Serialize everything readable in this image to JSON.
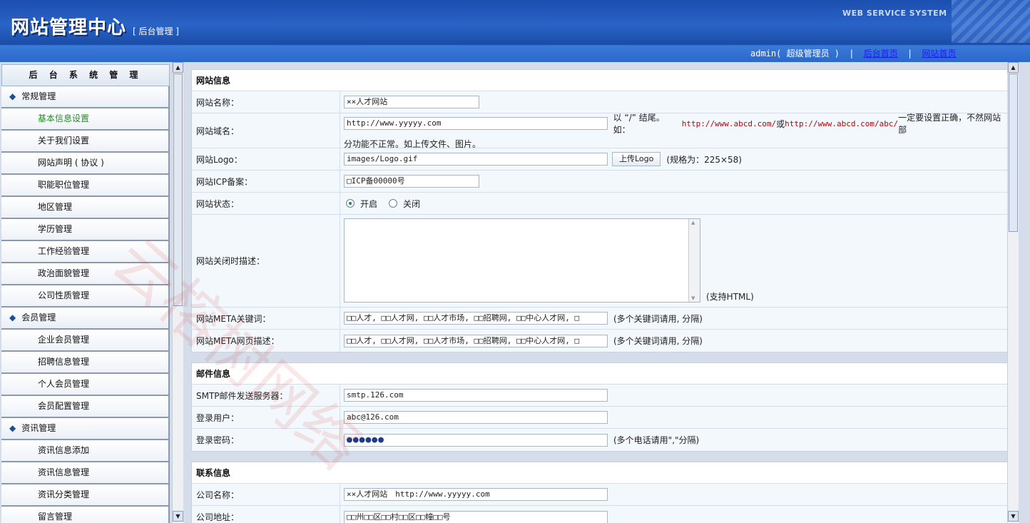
{
  "header": {
    "title": "网站管理中心",
    "subtitle": "[ 后台管理 ]",
    "system_label": "WEB SERVICE SYSTEM",
    "user": "admin( 超级管理员 )",
    "links": [
      "后台首页",
      "网站首页"
    ]
  },
  "sidebar": {
    "title": "后 台 系 统 管 理",
    "items": [
      {
        "type": "group",
        "label": "常规管理"
      },
      {
        "type": "item",
        "label": "基本信息设置",
        "active": true
      },
      {
        "type": "item",
        "label": "关于我们设置"
      },
      {
        "type": "item",
        "label": "网站声明 ( 协议 )"
      },
      {
        "type": "item",
        "label": "职能职位管理"
      },
      {
        "type": "item",
        "label": "地区管理"
      },
      {
        "type": "item",
        "label": "学历管理"
      },
      {
        "type": "item",
        "label": "工作经验管理"
      },
      {
        "type": "item",
        "label": "政治面貌管理"
      },
      {
        "type": "item",
        "label": "公司性质管理"
      },
      {
        "type": "group",
        "label": "会员管理"
      },
      {
        "type": "item",
        "label": "企业会员管理"
      },
      {
        "type": "item",
        "label": "招聘信息管理"
      },
      {
        "type": "item",
        "label": "个人会员管理"
      },
      {
        "type": "item",
        "label": "会员配置管理"
      },
      {
        "type": "group",
        "label": "资讯管理"
      },
      {
        "type": "item",
        "label": "资讯信息添加"
      },
      {
        "type": "item",
        "label": "资讯信息管理"
      },
      {
        "type": "item",
        "label": "资讯分类管理"
      },
      {
        "type": "item",
        "label": "留言管理"
      }
    ]
  },
  "site_info": {
    "heading": "网站信息",
    "name_label": "网站名称：",
    "name_value": "××人才网站",
    "domain_label": "网站域名：",
    "domain_value": "http://www.yyyyy.com",
    "domain_hint_a": "以 “/” 结尾。如：",
    "domain_hint_ex1": "http://www.abcd.com/",
    "domain_hint_or": " 或 ",
    "domain_hint_ex2": "http://www.abcd.com/abc/",
    "domain_hint_b": " 一定要设置正确，不然网站部",
    "domain_hint_c": "分功能不正常。如上传文件、图片。",
    "logo_label": "网站Logo：",
    "logo_value": "images/Logo.gif",
    "logo_button": "上传Logo",
    "logo_hint": "(规格为：225×58)",
    "icp_label": "网站ICP备案：",
    "icp_value": "□ICP备00000号",
    "status_label": "网站状态：",
    "status_open": "开启",
    "status_close": "关闭",
    "closed_desc_label": "网站关闭时描述：",
    "closed_desc_hint": "(支持HTML)",
    "meta_kw_label": "网站META关键词：",
    "meta_kw_value": "□□人才, □□人才网, □□人才市场, □□招聘网, □□中心人才网, □",
    "meta_kw_hint": "(多个关键词请用, 分隔)",
    "meta_desc_label": "网站META网页描述：",
    "meta_desc_value": "□□人才, □□人才网, □□人才市场, □□招聘网, □□中心人才网, □",
    "meta_desc_hint": "(多个关键词请用, 分隔)"
  },
  "mail_info": {
    "heading": "邮件信息",
    "smtp_label": "SMTP邮件发送服务器：",
    "smtp_value": "smtp.126.com",
    "user_label": "登录用户：",
    "user_value": "abc@126.com",
    "pwd_label": "登录密码：",
    "pwd_value": "●●●●●●",
    "pwd_hint": "(多个电话请用\",\"分隔)"
  },
  "contact_info": {
    "heading": "联系信息",
    "company_label": "公司名称：",
    "company_value": "××人才网站　http://www.yyyyy.com",
    "address_label": "公司地址：",
    "address_value": "□□州□□区□□村□□区□□幢□□号"
  },
  "watermark": "云榕树网络"
}
